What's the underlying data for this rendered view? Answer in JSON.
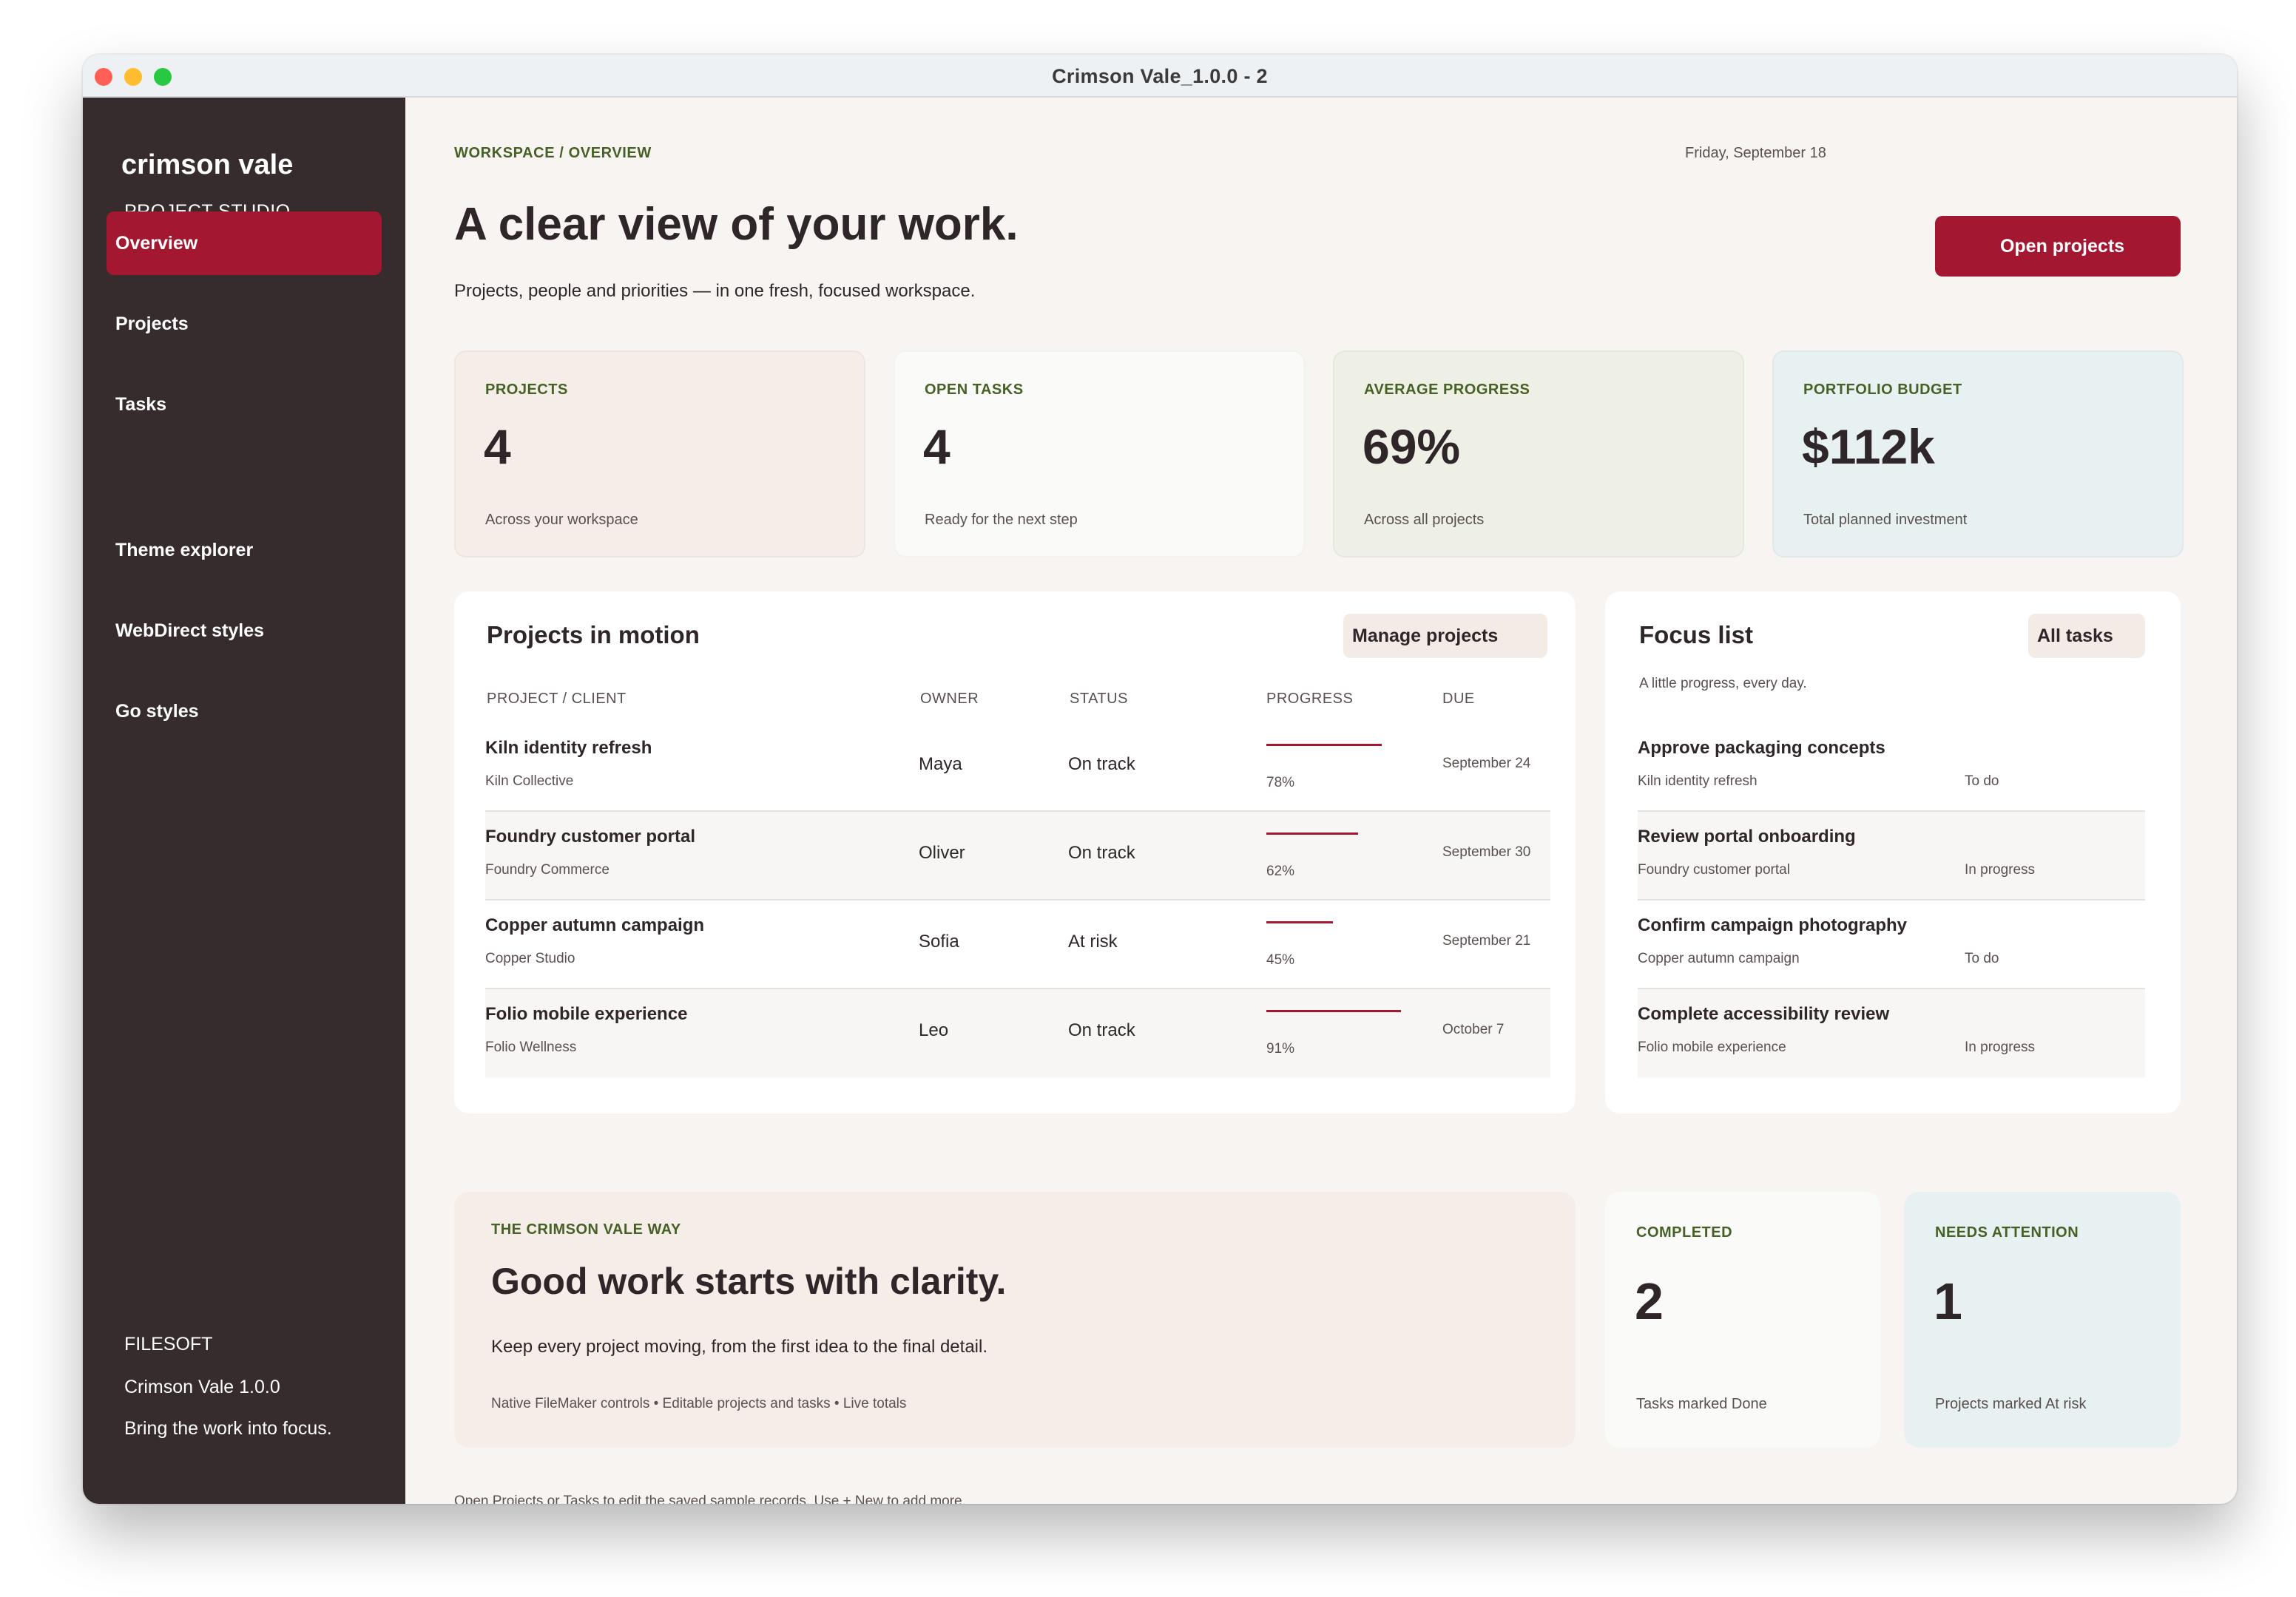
{
  "window": {
    "title": "Crimson Vale_1.0.0 - 2"
  },
  "sidebar": {
    "brand": "crimson vale",
    "subtitle": "PROJECT STUDIO",
    "nav": [
      {
        "label": "Overview",
        "active": true
      },
      {
        "label": "Projects"
      },
      {
        "label": "Tasks"
      },
      {
        "label": "Theme explorer"
      },
      {
        "label": "WebDirect styles"
      },
      {
        "label": "Go styles"
      }
    ],
    "footer": {
      "company": "FILESOFT",
      "version": "Crimson Vale 1.0.0",
      "tagline": "Bring the work into focus."
    }
  },
  "header": {
    "breadcrumb": "WORKSPACE / OVERVIEW",
    "date": "Friday, September 18",
    "title": "A clear view of your work.",
    "subtitle": "Projects, people and priorities — in one fresh, focused workspace.",
    "open_projects_label": "Open projects"
  },
  "stats": [
    {
      "label": "PROJECTS",
      "value": "4",
      "note": "Across your workspace",
      "color": "#f5ede8"
    },
    {
      "label": "OPEN TASKS",
      "value": "4",
      "note": "Ready for the next step",
      "color": "#fafaf9"
    },
    {
      "label": "AVERAGE PROGRESS",
      "value": "69%",
      "note": "Across all projects",
      "color": "#eff0e5"
    },
    {
      "label": "PORTFOLIO BUDGET",
      "value": "$112k",
      "note": "Total planned investment",
      "color": "#e8f1f1"
    }
  ],
  "projects_card": {
    "title": "Projects in motion",
    "manage_label": "Manage projects",
    "columns": [
      "PROJECT / CLIENT",
      "OWNER",
      "STATUS",
      "PROGRESS",
      "DUE"
    ],
    "rows": [
      {
        "name": "Kiln identity refresh",
        "client": "Kiln Collective",
        "owner": "Maya",
        "status": "On track",
        "progress": 78,
        "progress_label": "78%",
        "due": "September 24"
      },
      {
        "name": "Foundry customer portal",
        "client": "Foundry Commerce",
        "owner": "Oliver",
        "status": "On track",
        "progress": 62,
        "progress_label": "62%",
        "due": "September 30"
      },
      {
        "name": "Copper autumn campaign",
        "client": "Copper Studio",
        "owner": "Sofia",
        "status": "At risk",
        "progress": 45,
        "progress_label": "45%",
        "due": "September 21"
      },
      {
        "name": "Folio mobile experience",
        "client": "Folio Wellness",
        "owner": "Leo",
        "status": "On track",
        "progress": 91,
        "progress_label": "91%",
        "due": "October 7"
      }
    ]
  },
  "focus_card": {
    "title": "Focus list",
    "all_tasks_label": "All tasks",
    "subtitle": "A little progress, every day.",
    "items": [
      {
        "task": "Approve packaging concepts",
        "project": "Kiln identity refresh",
        "status": "To do"
      },
      {
        "task": "Review portal onboarding",
        "project": "Foundry customer portal",
        "status": "In progress"
      },
      {
        "task": "Confirm campaign photography",
        "project": "Copper autumn campaign",
        "status": "To do"
      },
      {
        "task": "Complete accessibility review",
        "project": "Folio mobile experience",
        "status": "In progress"
      }
    ]
  },
  "way": {
    "eyebrow": "THE CRIMSON VALE WAY",
    "headline": "Good work starts with clarity.",
    "body": "Keep every project moving, from the first idea to the final detail.",
    "features": "Native FileMaker controls • Editable projects and tasks • Live totals"
  },
  "completed": {
    "label": "COMPLETED",
    "value": "2",
    "note": "Tasks marked Done"
  },
  "attention": {
    "label": "NEEDS ATTENTION",
    "value": "1",
    "note": "Projects marked At risk"
  },
  "footnote": "Open Projects or Tasks to edit the saved sample records. Use + New to add more.",
  "colors": {
    "accent": "#a31830",
    "sidebar": "#362c2e",
    "eyebrow": "#466126",
    "canvas": "#f8f4f1"
  }
}
